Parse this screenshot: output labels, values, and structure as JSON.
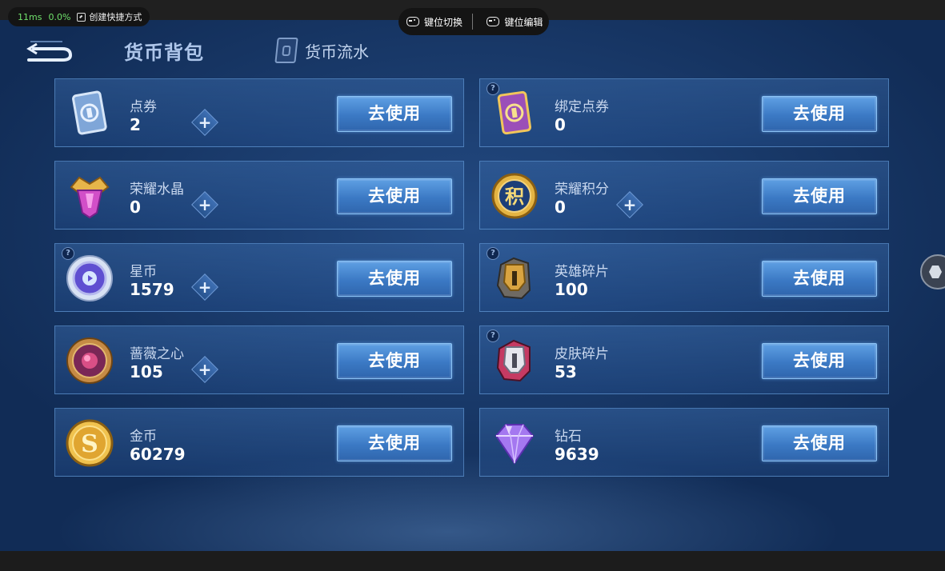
{
  "overlay": {
    "latency": "11ms",
    "loss": "0.0%",
    "shortcut_label": "创建快捷方式",
    "key_switch_label": "键位切换",
    "key_edit_label": "键位编辑"
  },
  "header": {
    "title": "货币背包",
    "ledger_tab": "货币流水"
  },
  "use_label": "去使用",
  "currencies": [
    {
      "name": "点券",
      "value": "2",
      "icon": "coupon-card-icon",
      "has_plus": true,
      "has_help": false
    },
    {
      "name": "绑定点券",
      "value": "0",
      "icon": "bound-coupon-card-icon",
      "has_plus": false,
      "has_help": true
    },
    {
      "name": "荣耀水晶",
      "value": "0",
      "icon": "glory-crystal-icon",
      "has_plus": true,
      "has_help": false
    },
    {
      "name": "荣耀积分",
      "value": "0",
      "icon": "glory-points-icon",
      "has_plus": true,
      "has_help": false
    },
    {
      "name": "星币",
      "value": "1579",
      "icon": "star-coin-icon",
      "has_plus": true,
      "has_help": true
    },
    {
      "name": "英雄碎片",
      "value": "100",
      "icon": "hero-fragment-icon",
      "has_plus": false,
      "has_help": true
    },
    {
      "name": "蔷薇之心",
      "value": "105",
      "icon": "rose-heart-icon",
      "has_plus": true,
      "has_help": false
    },
    {
      "name": "皮肤碎片",
      "value": "53",
      "icon": "skin-fragment-icon",
      "has_plus": false,
      "has_help": true
    },
    {
      "name": "金币",
      "value": "60279",
      "icon": "gold-coin-icon",
      "has_plus": false,
      "has_help": false
    },
    {
      "name": "钻石",
      "value": "9639",
      "icon": "diamond-icon",
      "has_plus": false,
      "has_help": false
    }
  ],
  "colors": {
    "background": "#163764",
    "button": "#3b79c4",
    "accent_text": "#aec6ea"
  }
}
